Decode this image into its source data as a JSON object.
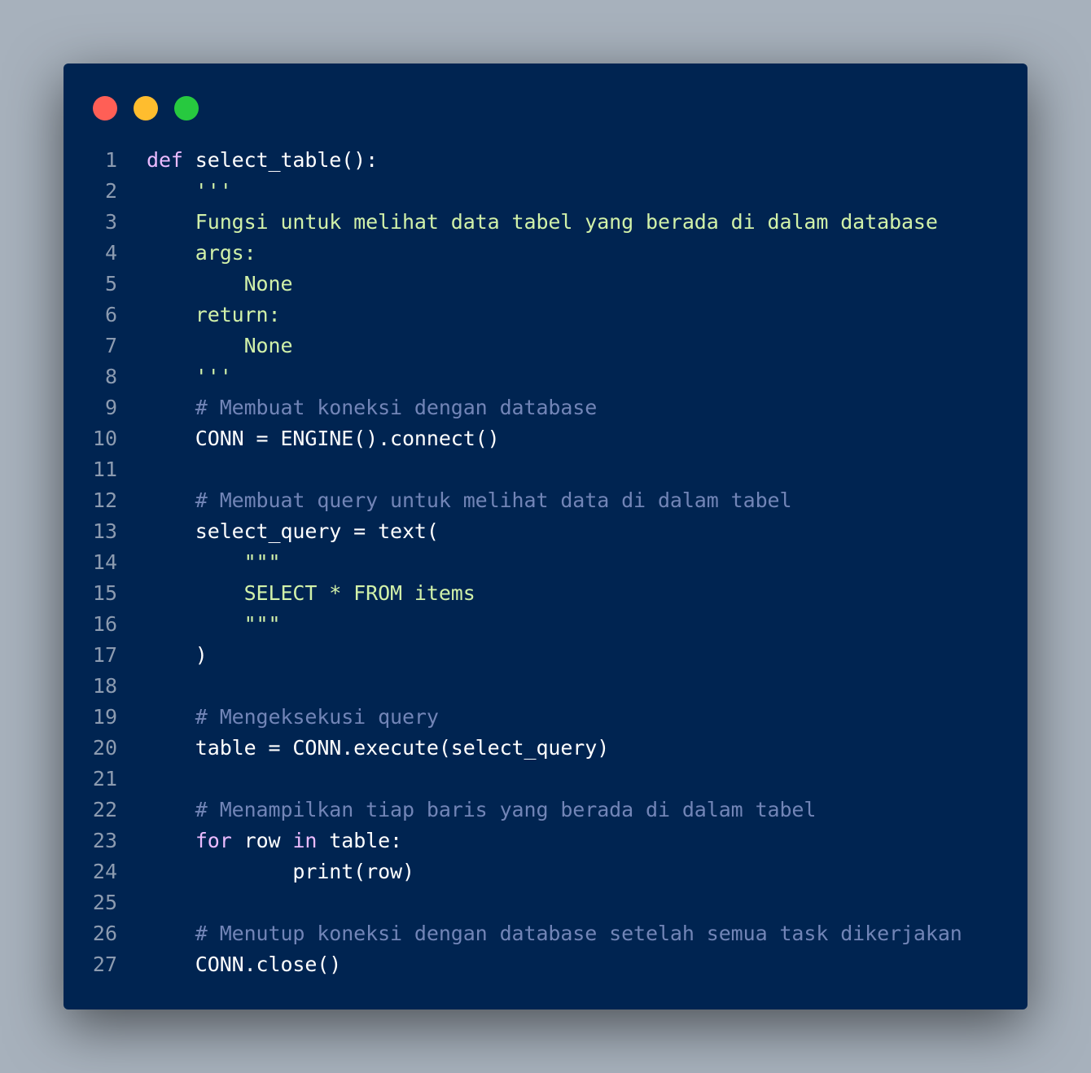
{
  "window_controls": {
    "close_color": "#ff5f56",
    "minimize_color": "#ffbd2e",
    "maximize_color": "#27c93f"
  },
  "code_lines": [
    {
      "n": "1",
      "tokens": [
        {
          "t": "def",
          "k": "kw"
        },
        {
          "t": " select_table():",
          "k": "fn"
        }
      ]
    },
    {
      "n": "2",
      "tokens": [
        {
          "t": "    '''",
          "k": "str"
        }
      ]
    },
    {
      "n": "3",
      "tokens": [
        {
          "t": "    Fungsi untuk melihat data tabel yang berada di dalam database",
          "k": "str"
        }
      ]
    },
    {
      "n": "4",
      "tokens": [
        {
          "t": "    args:",
          "k": "str"
        }
      ]
    },
    {
      "n": "5",
      "tokens": [
        {
          "t": "        None",
          "k": "str"
        }
      ]
    },
    {
      "n": "6",
      "tokens": [
        {
          "t": "    return:",
          "k": "str"
        }
      ]
    },
    {
      "n": "7",
      "tokens": [
        {
          "t": "        None",
          "k": "str"
        }
      ]
    },
    {
      "n": "8",
      "tokens": [
        {
          "t": "    '''",
          "k": "str"
        }
      ]
    },
    {
      "n": "9",
      "tokens": [
        {
          "t": "    # Membuat koneksi dengan database",
          "k": "cm"
        }
      ]
    },
    {
      "n": "10",
      "tokens": [
        {
          "t": "    CONN = ENGINE().connect()",
          "k": "fn"
        }
      ]
    },
    {
      "n": "11",
      "tokens": []
    },
    {
      "n": "12",
      "tokens": [
        {
          "t": "    # Membuat query untuk melihat data di dalam tabel",
          "k": "cm"
        }
      ]
    },
    {
      "n": "13",
      "tokens": [
        {
          "t": "    select_query = text(",
          "k": "fn"
        }
      ]
    },
    {
      "n": "14",
      "tokens": [
        {
          "t": "        \"\"\"",
          "k": "str"
        }
      ]
    },
    {
      "n": "15",
      "tokens": [
        {
          "t": "        SELECT * FROM items",
          "k": "str"
        }
      ]
    },
    {
      "n": "16",
      "tokens": [
        {
          "t": "        \"\"\"",
          "k": "str"
        }
      ]
    },
    {
      "n": "17",
      "tokens": [
        {
          "t": "    )",
          "k": "fn"
        }
      ]
    },
    {
      "n": "18",
      "tokens": []
    },
    {
      "n": "19",
      "tokens": [
        {
          "t": "    # Mengeksekusi query",
          "k": "cm"
        }
      ]
    },
    {
      "n": "20",
      "tokens": [
        {
          "t": "    table = CONN.execute(select_query)",
          "k": "fn"
        }
      ]
    },
    {
      "n": "21",
      "tokens": []
    },
    {
      "n": "22",
      "tokens": [
        {
          "t": "    # Menampilkan tiap baris yang berada di dalam tabel",
          "k": "cm"
        }
      ]
    },
    {
      "n": "23",
      "tokens": [
        {
          "t": "    ",
          "k": "fn"
        },
        {
          "t": "for",
          "k": "kw"
        },
        {
          "t": " row ",
          "k": "fn"
        },
        {
          "t": "in",
          "k": "kw"
        },
        {
          "t": " table:",
          "k": "fn"
        }
      ]
    },
    {
      "n": "24",
      "tokens": [
        {
          "t": "            print(row)",
          "k": "fn"
        }
      ]
    },
    {
      "n": "25",
      "tokens": []
    },
    {
      "n": "26",
      "tokens": [
        {
          "t": "    # Menutup koneksi dengan database setelah semua task dikerjakan",
          "k": "cm"
        }
      ]
    },
    {
      "n": "27",
      "tokens": [
        {
          "t": "    CONN.close()",
          "k": "fn"
        }
      ]
    }
  ]
}
